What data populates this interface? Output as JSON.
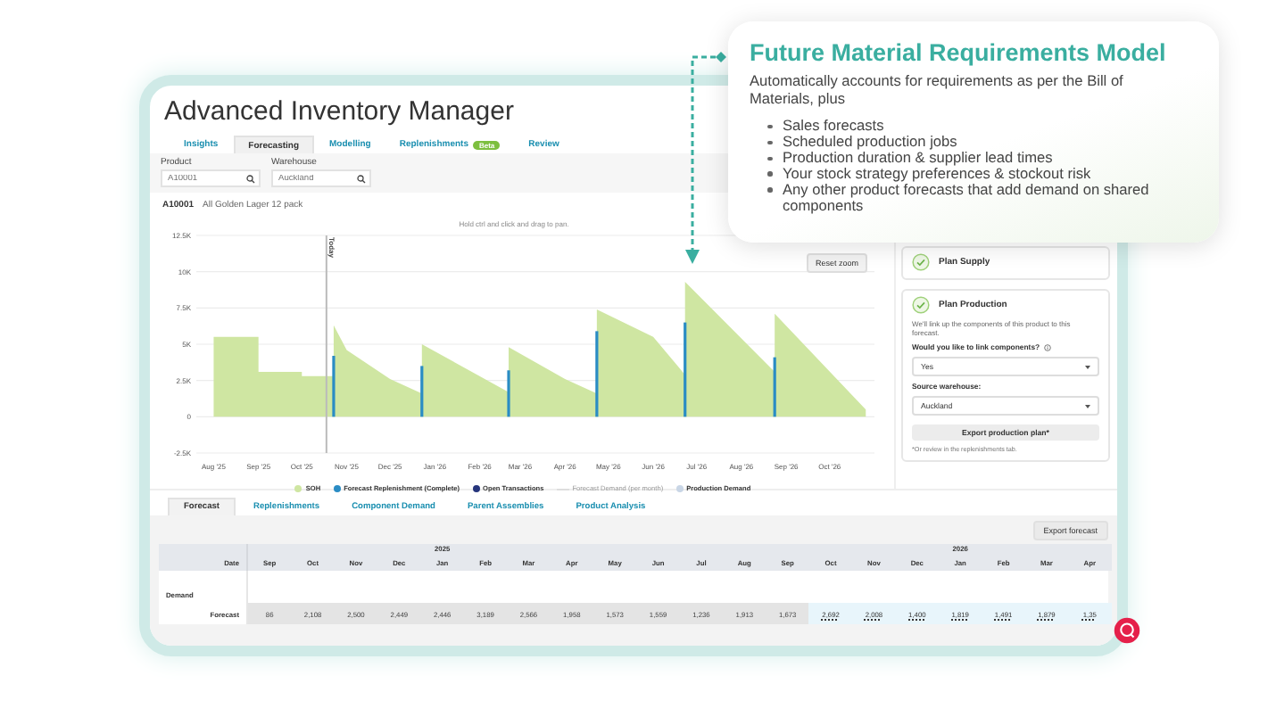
{
  "app": {
    "title": "Advanced Inventory Manager"
  },
  "tabs": [
    {
      "label": "Insights",
      "selected": false
    },
    {
      "label": "Forecasting",
      "selected": true
    },
    {
      "label": "Modelling",
      "selected": false
    },
    {
      "label": "Replenishments",
      "selected": false,
      "badge": "Beta"
    },
    {
      "label": "Review",
      "selected": false
    }
  ],
  "filters": [
    {
      "label": "Product",
      "value": "A10001"
    },
    {
      "label": "Warehouse",
      "value": "Auckland"
    }
  ],
  "product": {
    "code": "A10001",
    "name": "All Golden Lager 12 pack"
  },
  "chart": {
    "hint": "Hold ctrl and click and drag to pan.",
    "reset_button": "Reset zoom",
    "chart_data": {
      "type": "area",
      "x": [
        "2025-08-01",
        "2025-09-01",
        "2025-09-01",
        "2025-10-01",
        "2025-10-01",
        "2025-10-23",
        "2025-10-23",
        "2025-11-01",
        "2025-12-01",
        "2025-12-23",
        "2025-12-23",
        "2026-02-21",
        "2026-02-21",
        "2026-04-01",
        "2026-04-23",
        "2026-04-23",
        "2026-06-01",
        "2026-06-23",
        "2026-06-23",
        "2026-08-24",
        "2026-08-24",
        "2026-10-26"
      ],
      "series": [
        {
          "name": "SOH",
          "color": "#cfe6a2",
          "values": [
            5500,
            5500,
            3100,
            3100,
            2800,
            2800,
            6300,
            4600,
            2600,
            1600,
            5000,
            1700,
            4800,
            2600,
            1600,
            7400,
            5500,
            2900,
            9300,
            3100,
            7100,
            500
          ]
        },
        {
          "name": "Forecast Replenishment (Complete)",
          "color": "#2a8cc4",
          "values": [
            null,
            null,
            null,
            null,
            null,
            4200,
            null,
            null,
            null,
            3500,
            null,
            3200,
            null,
            null,
            5900,
            null,
            null,
            6500,
            null,
            4100,
            null,
            null
          ]
        }
      ],
      "xlim": [
        "2025-07-20",
        "2026-11-01"
      ],
      "ylim": [
        -2500,
        12500
      ],
      "grid": true,
      "xticks": [
        {
          "value": "2025-08-01",
          "label": "Aug '25"
        },
        {
          "value": "2025-09-01",
          "label": "Sep '25"
        },
        {
          "value": "2025-10-01",
          "label": "Oct '25"
        },
        {
          "value": "2025-11-01",
          "label": "Nov '25"
        },
        {
          "value": "2025-12-01",
          "label": "Dec '25"
        },
        {
          "value": "2026-01-01",
          "label": "Jan '26"
        },
        {
          "value": "2026-02-01",
          "label": "Feb '26"
        },
        {
          "value": "2026-03-01",
          "label": "Mar '26"
        },
        {
          "value": "2026-04-01",
          "label": "Apr '26"
        },
        {
          "value": "2026-05-01",
          "label": "May '26"
        },
        {
          "value": "2026-06-01",
          "label": "Jun '26"
        },
        {
          "value": "2026-07-01",
          "label": "Jul '26"
        },
        {
          "value": "2026-08-01",
          "label": "Aug '26"
        },
        {
          "value": "2026-09-01",
          "label": "Sep '26"
        },
        {
          "value": "2026-10-01",
          "label": "Oct '26"
        }
      ],
      "yticks": [
        {
          "value": -2500,
          "label": "-2.5K"
        },
        {
          "value": 0,
          "label": "0"
        },
        {
          "value": 2500,
          "label": "2.5K"
        },
        {
          "value": 5000,
          "label": "5K"
        },
        {
          "value": 7500,
          "label": "7.5K"
        },
        {
          "value": 10000,
          "label": "10K"
        },
        {
          "value": 12500,
          "label": "12.5K"
        }
      ],
      "ref_lines": [
        {
          "axis": "x",
          "value": "2025-10-18",
          "label": "Today"
        }
      ]
    },
    "legend_extra": [
      {
        "label": "Open Transactions",
        "kind": "dot",
        "color": "#26357c",
        "hidden": false
      },
      {
        "label": "Forecast Demand (per month)",
        "kind": "line",
        "color": "#dddddd",
        "hidden": true
      },
      {
        "label": "Production Demand",
        "kind": "dot",
        "color": "#c9d6e6",
        "hidden": false
      }
    ]
  },
  "steps": [
    {
      "title": "Plan Supply",
      "done": true
    },
    {
      "title": "Plan Production",
      "done": true,
      "description": "We'll link up the components of this product to this forecast.",
      "fields": [
        {
          "label": "Would you like to link components?",
          "info": true,
          "value": "Yes"
        },
        {
          "label": "Source warehouse:",
          "info": false,
          "value": "Auckland"
        }
      ],
      "button": "Export production plan*",
      "note": "*Or review in the replenishments tab."
    }
  ],
  "bottom_tabs": [
    {
      "label": "Forecast",
      "selected": true
    },
    {
      "label": "Replenishments",
      "selected": false
    },
    {
      "label": "Component Demand",
      "selected": false
    },
    {
      "label": "Parent Assemblies",
      "selected": false
    },
    {
      "label": "Product Analysis",
      "selected": false
    }
  ],
  "export_button": "Export forecast",
  "table": {
    "header_label": "Date",
    "columns": [
      {
        "month": "Sep"
      },
      {
        "month": "Oct"
      },
      {
        "month": "Nov"
      },
      {
        "month": "Dec"
      },
      {
        "month": "Jan",
        "year": "2025"
      },
      {
        "month": "Feb"
      },
      {
        "month": "Mar"
      },
      {
        "month": "Apr"
      },
      {
        "month": "May"
      },
      {
        "month": "Jun"
      },
      {
        "month": "Jul"
      },
      {
        "month": "Aug"
      },
      {
        "month": "Sep"
      },
      {
        "month": "Oct"
      },
      {
        "month": "Nov"
      },
      {
        "month": "Dec"
      },
      {
        "month": "Jan",
        "year": "2026"
      },
      {
        "month": "Feb"
      },
      {
        "month": "Mar"
      },
      {
        "month": "Apr"
      }
    ],
    "rows": [
      {
        "kind": "section",
        "label": "Demand"
      },
      {
        "kind": "values",
        "label": "Forecast",
        "cells": [
          {
            "value": "86",
            "editable": false
          },
          {
            "value": "2,108",
            "editable": false
          },
          {
            "value": "2,500",
            "editable": false
          },
          {
            "value": "2,449",
            "editable": false
          },
          {
            "value": "2,446",
            "editable": false
          },
          {
            "value": "3,189",
            "editable": false
          },
          {
            "value": "2,566",
            "editable": false
          },
          {
            "value": "1,958",
            "editable": false
          },
          {
            "value": "1,573",
            "editable": false
          },
          {
            "value": "1,559",
            "editable": false
          },
          {
            "value": "1,236",
            "editable": false
          },
          {
            "value": "1,913",
            "editable": false
          },
          {
            "value": "1,673",
            "editable": false
          },
          {
            "value": "2,692",
            "editable": true
          },
          {
            "value": "2,008",
            "editable": true
          },
          {
            "value": "1,400",
            "editable": true
          },
          {
            "value": "1,819",
            "editable": true
          },
          {
            "value": "1,491",
            "editable": true
          },
          {
            "value": "1,879",
            "editable": true
          },
          {
            "value": "1,35",
            "editable": true
          }
        ]
      }
    ]
  },
  "callout": {
    "title": "Future Material Requirements Model",
    "intro": "Automatically accounts for requirements as per the Bill of Materials, plus",
    "points": [
      "Sales forecasts",
      "Scheduled production jobs",
      "Production duration & supplier lead times",
      "Your stock strategy preferences & stockout risk",
      "Any other product forecasts that add demand on shared components"
    ]
  }
}
